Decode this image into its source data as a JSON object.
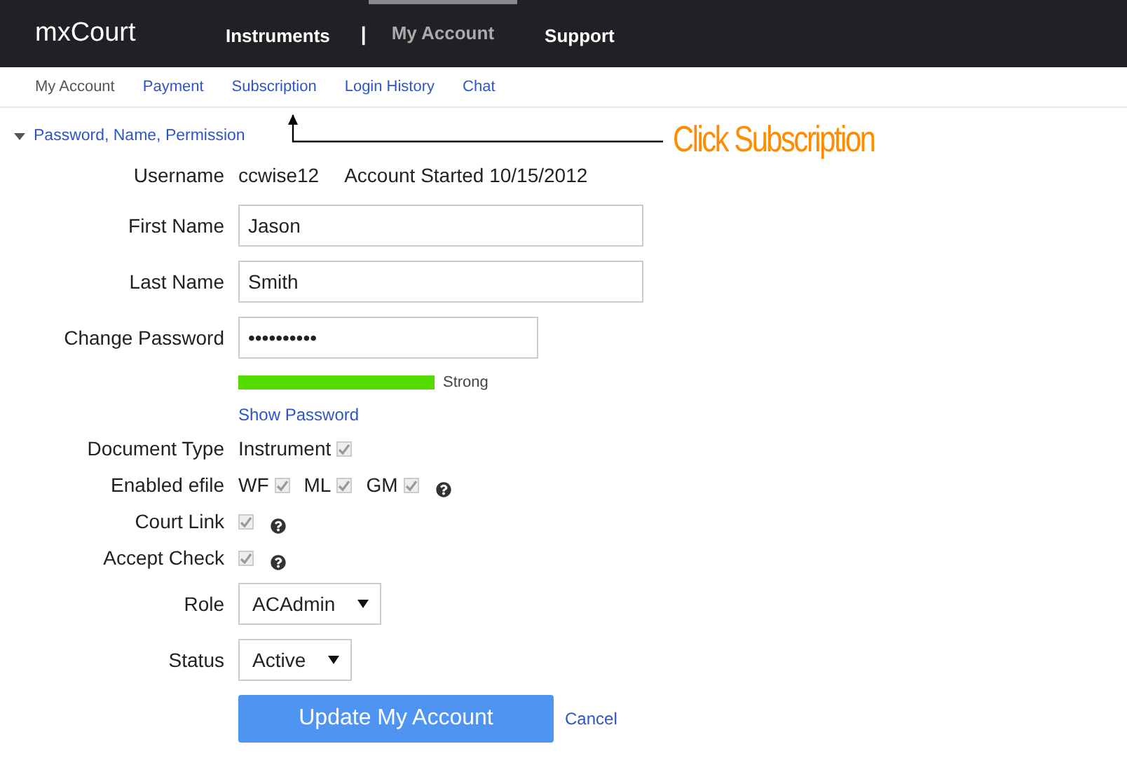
{
  "brand": "mxCourt",
  "top_nav": [
    {
      "label": "Instruments",
      "selected": false
    },
    {
      "label": "|",
      "kind": "separator"
    },
    {
      "label": "My Account",
      "selected": true
    },
    {
      "label": "Support",
      "selected": false
    }
  ],
  "sub_nav": [
    {
      "label": "My Account",
      "selected": true
    },
    {
      "label": "Payment",
      "selected": false
    },
    {
      "label": "Subscription",
      "selected": false
    },
    {
      "label": "Login History",
      "selected": false
    },
    {
      "label": "Chat",
      "selected": false
    }
  ],
  "section": {
    "title": "Password, Name, Permission",
    "expanded": true
  },
  "annotation": "Click Subscription",
  "rows": [
    {
      "kind": "text",
      "label": "Username",
      "value": "ccwise12",
      "extra": "Account Started 10/15/2012"
    },
    {
      "kind": "input",
      "label": "First Name",
      "value": "Jason"
    },
    {
      "kind": "input",
      "label": "Last Name",
      "value": "Smith"
    },
    {
      "kind": "password",
      "label": "Change Password",
      "value": "••••••••••"
    },
    {
      "kind": "strength",
      "reading": "Strong"
    },
    {
      "kind": "link",
      "text": "Show Password"
    },
    {
      "kind": "checks",
      "label": "Document Type",
      "options": [
        {
          "label": "Instrument",
          "checked": true
        }
      ]
    },
    {
      "kind": "checks",
      "label": "Enabled efile",
      "options": [
        {
          "label": "WF",
          "checked": true
        },
        {
          "label": "ML",
          "checked": true
        },
        {
          "label": "GM",
          "checked": true
        }
      ],
      "help": true
    },
    {
      "kind": "checks",
      "label": "Court Link",
      "options": [
        {
          "checked": true
        }
      ],
      "help": true
    },
    {
      "kind": "checks",
      "label": "Accept Check",
      "options": [
        {
          "checked": true
        }
      ],
      "help": true
    },
    {
      "kind": "select",
      "label": "Role",
      "value": "ACAdmin"
    },
    {
      "kind": "select",
      "label": "Status",
      "value": "Active"
    }
  ],
  "buttons": {
    "submit": "Update My Account",
    "cancel": "Cancel"
  }
}
